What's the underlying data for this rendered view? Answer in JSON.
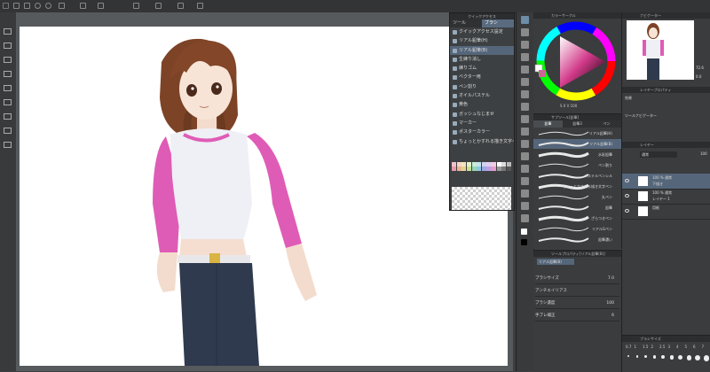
{
  "colors": {
    "accent": "#5a6b80",
    "canvas": "#ffffff",
    "shirt_body": "#efeff6",
    "shirt_sleeve": "#df5cb6",
    "jeans": "#2f3a4e",
    "hair": "#7d4326"
  },
  "toolbar": {
    "icons": [
      "new-icon",
      "open-icon",
      "save-icon",
      "undo-icon",
      "redo-icon",
      "transform-icon",
      "select-icon",
      "pen-icon",
      "grid-icon",
      "ruler-icon",
      "camera-icon",
      "text-icon"
    ]
  },
  "left_strip": {
    "icons": [
      "folder-icon",
      "folder-icon",
      "folder-icon",
      "folder-icon",
      "folder-icon",
      "folder-icon",
      "folder-icon",
      "folder-icon",
      "folder-icon",
      "folder-icon"
    ]
  },
  "float_panel": {
    "title": "クイックアクセス",
    "tabs": [
      "ツール",
      "ブラシ"
    ],
    "active_tab": 1,
    "items": [
      "クイックアクセス設定",
      "リアル鉛筆(H)",
      "リアル鉛筆(B)",
      "生練り消し",
      "練りゴム",
      "ベクター用",
      "ペン割り",
      "オイルパステル",
      "黄色",
      "ガッシュなじませ",
      "マーカー",
      "ポスターカラー",
      "ちょっとかすれる描き文字ペン"
    ],
    "selected_index": 2,
    "palette_label": "カラーセット"
  },
  "color_panel": {
    "title": "カラーサークル",
    "values": "S 0 V 100"
  },
  "brush_panel": {
    "title": "サブツール[鉛筆]",
    "tabs": [
      "鉛筆",
      "鉛筆3",
      "ペン"
    ],
    "active_tab": 0,
    "brushes": [
      "リアル鉛筆(H)",
      "リアル鉛筆(B)",
      "水彩鉛筆",
      "ペン割り",
      "パステルペンシル",
      "ちょっとかすれる描き文字ペン",
      "丸ペン",
      "鉛筆",
      "ざらつきペン",
      "リアルGペン",
      "鉛筆濃い"
    ],
    "selected_index": 1
  },
  "tool_property": {
    "title": "ツールプロパティ[リアル鉛筆(B)]",
    "name": "リアル鉛筆(B)",
    "rows": [
      {
        "label": "ブラシサイズ",
        "value": "7.0"
      },
      {
        "label": "アンチエイリアス",
        "value": ""
      },
      {
        "label": "ブラシ濃度",
        "value": "100"
      },
      {
        "label": "手ブレ補正",
        "value": "6"
      }
    ]
  },
  "navigator": {
    "title": "ナビゲーター",
    "zoom": "72.6",
    "angle": "0.0"
  },
  "layer_property": {
    "title": "レイヤープロパティ",
    "effect_label": "効果",
    "color_label": "ツールナビゲーター"
  },
  "layer_panel": {
    "title": "レイヤー",
    "blend_mode": "通常",
    "opacity": "100",
    "layers": [
      {
        "name": "100 % 通常",
        "sub": "下描き",
        "selected": true
      },
      {
        "name": "100 % 通常",
        "sub": "レイヤー 1",
        "selected": false
      },
      {
        "name": "用紙",
        "sub": "",
        "selected": false
      }
    ]
  },
  "brush_size_panel": {
    "title": "ブラシサイズ",
    "sizes": [
      "0.7",
      "1",
      "1.5",
      "2",
      "2.5",
      "3",
      "4",
      "5",
      "6",
      "7"
    ]
  }
}
